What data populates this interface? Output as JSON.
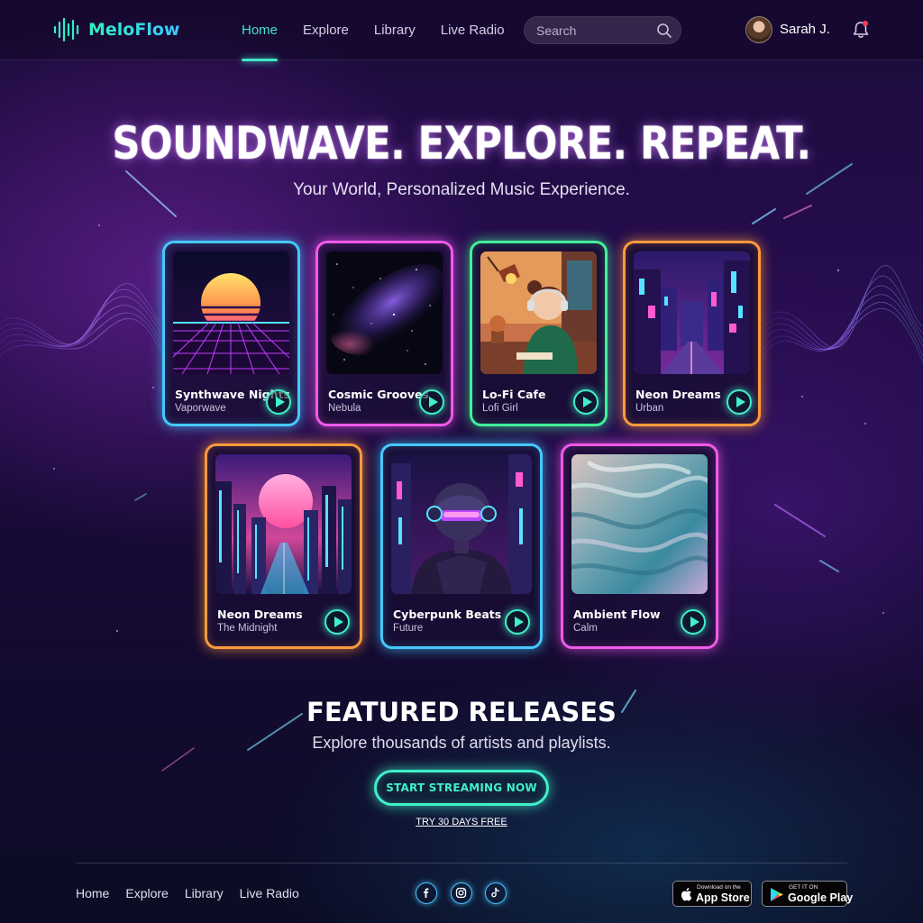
{
  "colors": {
    "accent_teal": "#3ff0c8",
    "card_blue": "#46c8ff",
    "card_pink": "#f05ae8",
    "card_green": "#42f09a",
    "card_orange": "#ff9a3c",
    "background_dark": "#170a35"
  },
  "header": {
    "brand": "MeloFlow",
    "brand_icon": "soundwave-icon",
    "nav": [
      {
        "label": "Home",
        "active": true
      },
      {
        "label": "Explore",
        "active": false
      },
      {
        "label": "Library",
        "active": false
      },
      {
        "label": "Live Radio",
        "active": false
      }
    ],
    "search": {
      "placeholder": "Search",
      "value": "",
      "icon": "search-icon"
    },
    "user": {
      "name": "Sarah J.",
      "avatar_icon": "avatar",
      "notification_icon": "bell-icon",
      "has_notification": true
    }
  },
  "hero": {
    "title": "SOUNDWAVE. EXPLORE. REPEAT.",
    "subtitle": "Your World, Personalized Music Experience."
  },
  "cards": [
    {
      "title": "Synthwave Nights",
      "subtitle": "Vaporwave",
      "border_color": "#46c8ff",
      "art": "retro sunset grid"
    },
    {
      "title": "Cosmic Grooves",
      "subtitle": "Nebula",
      "border_color": "#f05ae8",
      "art": "galaxy nebula"
    },
    {
      "title": "Lo-Fi Cafe",
      "subtitle": "Lofi Girl",
      "border_color": "#42f09a",
      "art": "girl studying with headphones"
    },
    {
      "title": "Neon Dreams",
      "subtitle": "Urban",
      "border_color": "#ff9a3c",
      "art": "neon city street"
    },
    {
      "title": "Neon Dreams",
      "subtitle": "The Midnight",
      "border_color": "#ff9a3c",
      "art": "neon skyline sunset"
    },
    {
      "title": "Cyberpunk Beats",
      "subtitle": "Future",
      "border_color": "#46c8ff",
      "art": "cyberpunk helmet figure"
    },
    {
      "title": "Ambient Flow",
      "subtitle": "Calm",
      "border_color": "#f05ae8",
      "art": "teal fur texture"
    }
  ],
  "featured": {
    "title": "FEATURED RELEASES",
    "subtitle": "Explore thousands of artists and playlists.",
    "cta_label": "START STREAMING NOW",
    "trial_link": "TRY 30 DAYS FREE"
  },
  "footer": {
    "nav": [
      "Home",
      "Explore",
      "Library",
      "Live Radio"
    ],
    "social": [
      "facebook-icon",
      "instagram-icon",
      "tiktok-icon"
    ],
    "app_store": {
      "small": "Download on the",
      "big": "App Store"
    },
    "google_play": {
      "small": "GET IT ON",
      "big": "Google Play"
    }
  }
}
